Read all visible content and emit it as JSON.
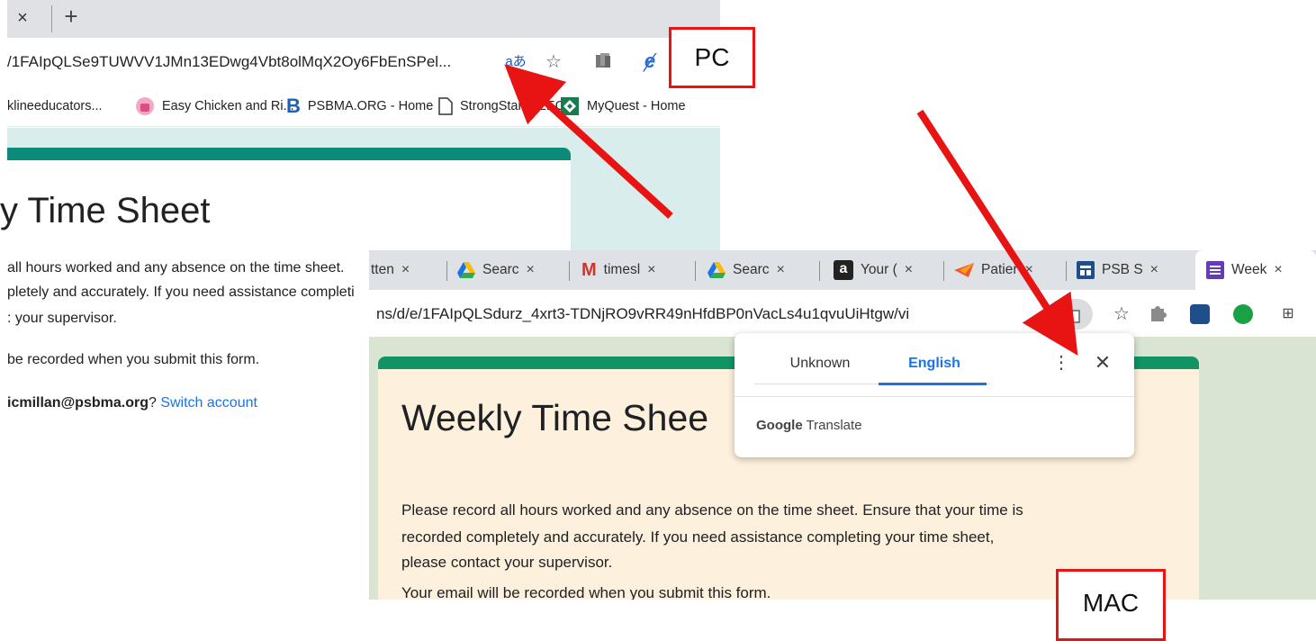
{
  "pc": {
    "tab_close": "×",
    "new_tab": "+",
    "url": "/1FAIpQLSe9TUWVV1JMn13EDwg4Vbt8olMqX2Oy6FbEnSPel...",
    "translate_glyph": "aあ",
    "bookmarks": [
      {
        "label": "klineeducators...",
        "icon": "none"
      },
      {
        "label": "Easy Chicken and Ri...",
        "icon": "recipe-icon"
      },
      {
        "label": "PSBMA.ORG - Home",
        "icon": "psbma-b-icon"
      },
      {
        "label": "StrongStart - EEC",
        "icon": "page-icon"
      },
      {
        "label": "MyQuest - Home",
        "icon": "myquest-icon"
      }
    ],
    "title": "y Time Sheet",
    "desc_lines": [
      "all hours worked and any absence on the time sheet.",
      "pletely and accurately. If you need assistance completi",
      ": your supervisor."
    ],
    "recorded": "be recorded when you submit this form.",
    "email": "icmillan@psbma.org",
    "question_mark": "?",
    "switch_account": "Switch account"
  },
  "mac": {
    "tabs": [
      {
        "label": "tten",
        "icon": "none"
      },
      {
        "label": "Searc",
        "icon": "drive-icon"
      },
      {
        "label": "timesl",
        "icon": "gmail-icon"
      },
      {
        "label": "Searc",
        "icon": "drive-icon"
      },
      {
        "label": "Your (",
        "icon": "amazon-icon"
      },
      {
        "label": "Patier",
        "icon": "patient-icon"
      },
      {
        "label": "PSB S",
        "icon": "sheets-icon"
      },
      {
        "label": "Week",
        "icon": "forms-icon"
      }
    ],
    "tab_close": "×",
    "url": "ns/d/e/1FAIpQLSdurz_4xrt3-TDNjRO9vRR49nHfdBP0nVacLs4u1qvuUiHtgw/vi",
    "title": "Weekly Time Shee",
    "desc_lines": [
      "Please record all hours worked and any absence on the time sheet.  Ensure that your time is",
      "recorded completely and accurately. If you need assistance completing your time sheet,",
      "please contact your supervisor."
    ],
    "recorded": "Your email will be recorded when you submit this form."
  },
  "translate_popup": {
    "tab_unknown": "Unknown",
    "tab_english": "English",
    "more": "⋮",
    "close": "✕",
    "brand_google": "Google",
    "brand_translate": " Translate"
  },
  "labels": {
    "pc": "PC",
    "mac": "MAC"
  },
  "colors": {
    "arrow": "#e81414",
    "label_border": "#e81414",
    "pc_theme": "#0c8a7a",
    "mac_theme": "#119364",
    "link": "#1a73e8"
  }
}
